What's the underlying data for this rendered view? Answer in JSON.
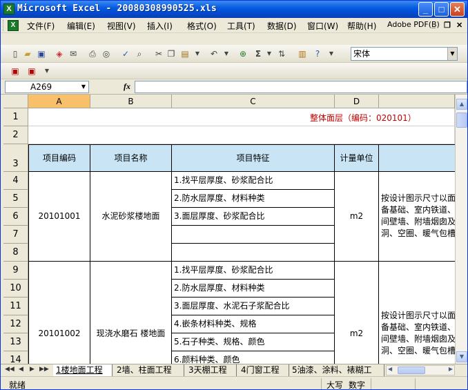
{
  "window": {
    "title": "Microsoft Excel - 20080308990525.xls",
    "app_icon": "excel-icon",
    "buttons": {
      "minimize": "_",
      "maximize": "□",
      "close": "✕"
    }
  },
  "menu": {
    "items": [
      "文件(F)",
      "编辑(E)",
      "视图(V)",
      "插入(I)",
      "格式(O)",
      "工具(T)",
      "数据(D)",
      "窗口(W)",
      "帮助(H)",
      "Adobe PDF(B)"
    ],
    "mdi_minimize": "_",
    "mdi_restore": "❐",
    "mdi_close": "✕"
  },
  "toolbar": {
    "font_name": "宋体",
    "sigma": "Σ"
  },
  "formula_bar": {
    "name_box": "A269",
    "fx": "fx",
    "content": ""
  },
  "sheet": {
    "columns": [
      "A",
      "B",
      "C",
      "D"
    ],
    "selected_column": "A",
    "rows": [
      "1",
      "2",
      "3",
      "4",
      "5",
      "6",
      "7",
      "8",
      "9",
      "10",
      "11",
      "12",
      "13",
      "14"
    ],
    "title_text": "整体面层（编码：020101）",
    "headers": {
      "code": "项目编码",
      "name": "项目名称",
      "feature": "项目特征",
      "unit": "计量单位"
    },
    "item1": {
      "code": "20101001",
      "name": "水泥砂浆楼地面",
      "unit": "m2",
      "features": [
        "1.找平层厚度、砂浆配合比",
        "2.防水层厚度、材料种类",
        "3.面层厚度、砂浆配合比"
      ],
      "rule_lines": [
        "按设计图示尺寸以面",
        "备基础、室内铁道、",
        "间壁墙、附墙烟囱及",
        "洞、空圈、暖气包槽"
      ]
    },
    "item2": {
      "code": "20101002",
      "name": "现浇水磨石 楼地面",
      "unit": "m2",
      "features": [
        "1.找平层厚度、砂浆配合比",
        "2.防水层厚度、材料种类",
        "3.面层厚度、水泥石子浆配合比",
        "4.嵌条材料种类、规格",
        "5.石子种类、规格、颜色",
        "6.颜料种类、颜色"
      ],
      "rule_lines": [
        "按设计图示尺寸以面",
        "备基础、室内铁道、",
        "间壁墙、附墙烟囱及",
        "洞、空圈、暖气包槽"
      ]
    }
  },
  "tabs": {
    "nav": [
      "◀◀",
      "◀",
      "▶",
      "▶▶"
    ],
    "items": [
      "1楼地面工程",
      "2墙、柱面工程",
      "3天棚工程",
      "4门窗工程",
      "5油漆、涂料、裱糊工"
    ]
  },
  "status": {
    "ready": "就绪",
    "caps": "大写",
    "num": "数字"
  }
}
